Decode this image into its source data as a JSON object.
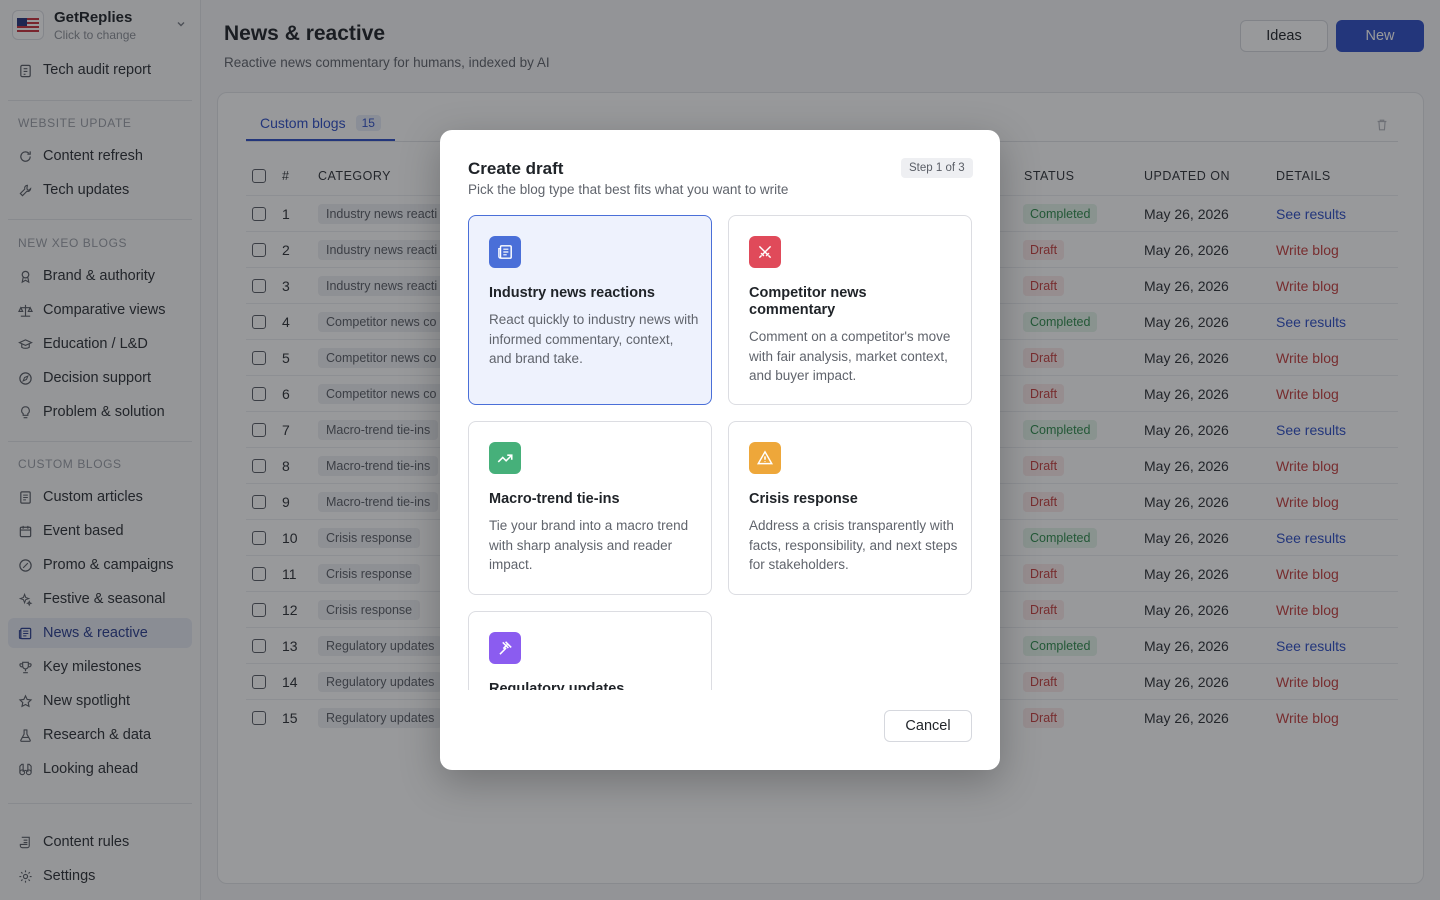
{
  "workspace": {
    "name": "GetReplies",
    "sub": "Click to change"
  },
  "sidebar": {
    "top_item": "Tech audit report",
    "sections": [
      {
        "label": "WEBSITE UPDATE",
        "items": [
          "Content refresh",
          "Tech updates"
        ]
      },
      {
        "label": "NEW XEO BLOGS",
        "items": [
          "Brand & authority",
          "Comparative views",
          "Education / L&D",
          "Decision support",
          "Problem & solution"
        ]
      },
      {
        "label": "CUSTOM BLOGS",
        "items": [
          "Custom articles",
          "Event based",
          "Promo & campaigns",
          "Festive & seasonal",
          "News & reactive",
          "Key milestones",
          "New spotlight",
          "Research & data",
          "Looking ahead"
        ]
      }
    ],
    "bottom_items": [
      "Content rules",
      "Settings"
    ],
    "active": "News & reactive"
  },
  "header": {
    "title": "News & reactive",
    "subtitle": "Reactive news commentary for humans, indexed by AI",
    "ideas_label": "Ideas",
    "new_label": "New"
  },
  "tabs": [
    {
      "label": "Custom blogs",
      "count": "15"
    }
  ],
  "table": {
    "headers": {
      "num": "#",
      "category": "CATEGORY",
      "status": "STATUS",
      "updated": "UPDATED ON",
      "details": "DETAILS"
    },
    "rows": [
      {
        "num": "1",
        "category": "Industry news reacti",
        "status": "Completed",
        "updated": "May 26, 2026",
        "details": "See results"
      },
      {
        "num": "2",
        "category": "Industry news reacti",
        "status": "Draft",
        "updated": "May 26, 2026",
        "details": "Write blog"
      },
      {
        "num": "3",
        "category": "Industry news reacti",
        "status": "Draft",
        "updated": "May 26, 2026",
        "details": "Write blog"
      },
      {
        "num": "4",
        "category": "Competitor news co",
        "status": "Completed",
        "updated": "May 26, 2026",
        "details": "See results"
      },
      {
        "num": "5",
        "category": "Competitor news co",
        "status": "Draft",
        "updated": "May 26, 2026",
        "details": "Write blog"
      },
      {
        "num": "6",
        "category": "Competitor news co",
        "status": "Draft",
        "updated": "May 26, 2026",
        "details": "Write blog"
      },
      {
        "num": "7",
        "category": "Macro-trend tie-ins",
        "status": "Completed",
        "updated": "May 26, 2026",
        "details": "See results"
      },
      {
        "num": "8",
        "category": "Macro-trend tie-ins",
        "status": "Draft",
        "updated": "May 26, 2026",
        "details": "Write blog"
      },
      {
        "num": "9",
        "category": "Macro-trend tie-ins",
        "status": "Draft",
        "updated": "May 26, 2026",
        "details": "Write blog"
      },
      {
        "num": "10",
        "category": "Crisis response",
        "status": "Completed",
        "updated": "May 26, 2026",
        "details": "See results"
      },
      {
        "num": "11",
        "category": "Crisis response",
        "status": "Draft",
        "updated": "May 26, 2026",
        "details": "Write blog"
      },
      {
        "num": "12",
        "category": "Crisis response",
        "status": "Draft",
        "updated": "May 26, 2026",
        "details": "Write blog"
      },
      {
        "num": "13",
        "category": "Regulatory updates",
        "status": "Completed",
        "updated": "May 26, 2026",
        "details": "See results"
      },
      {
        "num": "14",
        "category": "Regulatory updates",
        "status": "Draft",
        "updated": "May 26, 2026",
        "details": "Write blog"
      },
      {
        "num": "15",
        "category": "Regulatory updates",
        "status": "Draft",
        "updated": "May 26, 2026",
        "details": "Write blog"
      }
    ]
  },
  "modal": {
    "title": "Create draft",
    "subtitle": "Pick the blog type that best fits what you want to write",
    "step": "Step 1 of 3",
    "options": [
      {
        "title": "Industry news reactions",
        "desc": "React quickly to industry news with informed commentary, context, and brand take.",
        "icon": "newspaper-icon",
        "color": "#4a6fd8",
        "selected": true
      },
      {
        "title": "Competitor news commentary",
        "desc": "Comment on a competitor's move with fair analysis, market context, and buyer impact.",
        "icon": "swords-icon",
        "color": "#e04a5a",
        "selected": false
      },
      {
        "title": "Macro-trend tie-ins",
        "desc": "Tie your brand into a macro trend with sharp analysis and reader impact.",
        "icon": "trending-up-icon",
        "color": "#46b07a",
        "selected": false
      },
      {
        "title": "Crisis response",
        "desc": "Address a crisis transparently with facts, responsibility, and next steps for stakeholders.",
        "icon": "warning-icon",
        "color": "#eea73a",
        "selected": false
      },
      {
        "title": "Regulatory updates",
        "desc": "",
        "icon": "gavel-icon",
        "color": "#8b5cf0",
        "selected": false
      }
    ],
    "cancel_label": "Cancel"
  }
}
